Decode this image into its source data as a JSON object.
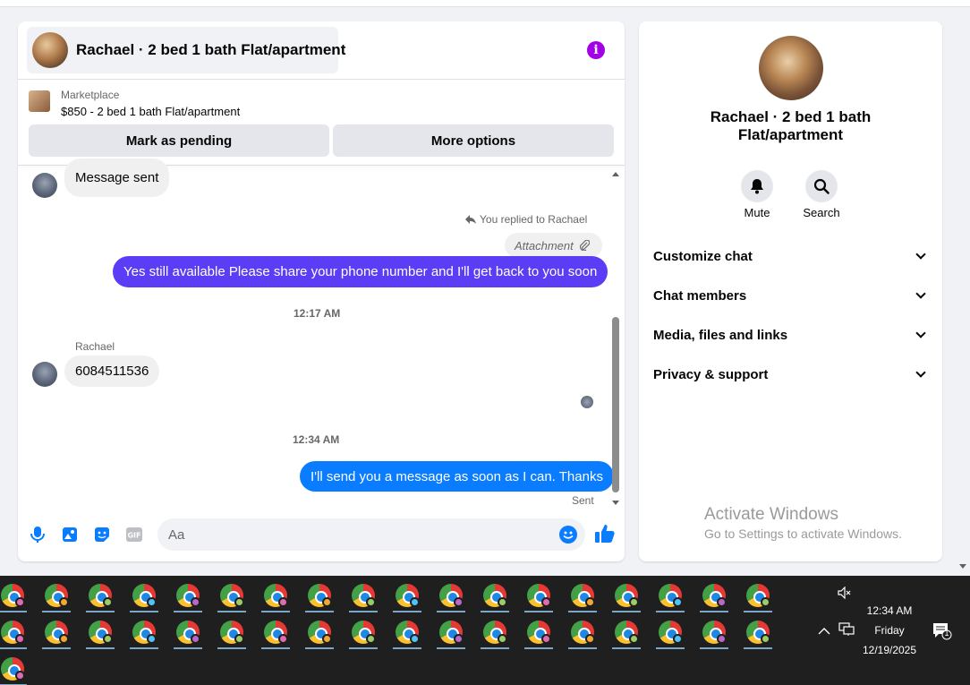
{
  "chat": {
    "title": "Rachael · 2 bed 1 bath Flat/apartment",
    "marketplace_label": "Marketplace",
    "listing": "$850 - 2 bed 1 bath Flat/apartment",
    "mark_pending": "Mark as pending",
    "more_options": "More options"
  },
  "messages": {
    "first_in": "Message sent",
    "replied_note": "You replied to Rachael",
    "attachment": "Attachment",
    "out_1": "Yes still available Please share your phone number and I'll get back to you soon",
    "time_1": "12:17 AM",
    "sender": "Rachael",
    "in_2": "6084511536",
    "time_2": "12:34 AM",
    "out_2": "I'll send you a message as soon as I can. Thanks",
    "status": "Sent"
  },
  "composer": {
    "placeholder": "Aa"
  },
  "info_panel": {
    "title": "Rachael · 2 bed 1 bath Flat/apartment",
    "mute": "Mute",
    "search": "Search",
    "sections": [
      "Customize chat",
      "Chat members",
      "Media, files and links",
      "Privacy & support"
    ]
  },
  "watermark": {
    "line1": "Activate Windows",
    "line2": "Go to Settings to activate Windows."
  },
  "taskbar": {
    "time": "12:34 AM",
    "day": "Friday",
    "date": "12/19/2025",
    "notification_count": "1",
    "badge_colors": [
      "#e06bb0",
      "#f0a830",
      "#9ccc65",
      "#4fc3f7",
      "#ba68c8",
      "#9ccc65"
    ]
  },
  "colors": {
    "outgoing_purple": "#5b3df5",
    "outgoing_blue": "#0a7cff",
    "info_icon": "#a200e6"
  }
}
